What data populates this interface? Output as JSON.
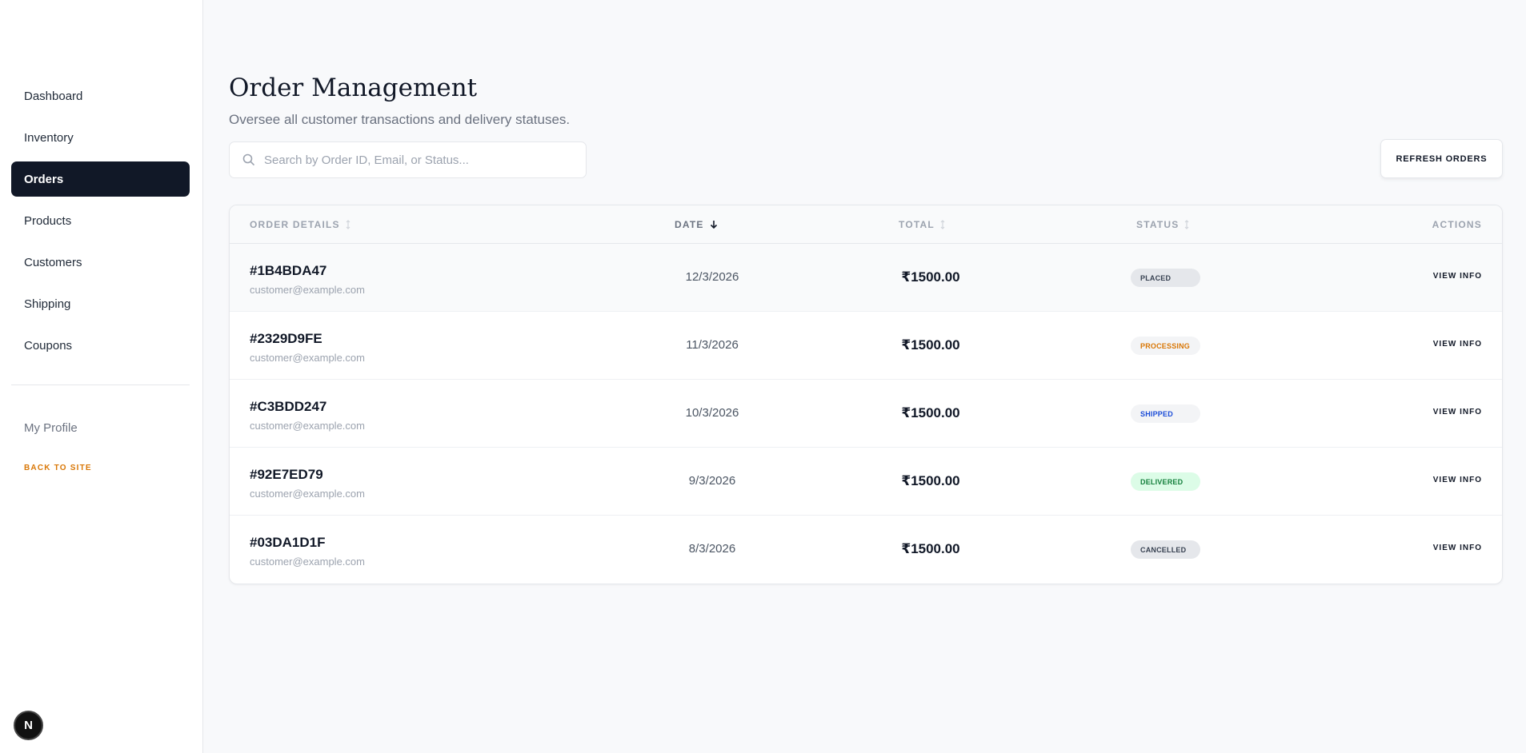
{
  "sidebar": {
    "nav": [
      {
        "label": "Dashboard",
        "active": false
      },
      {
        "label": "Inventory",
        "active": false
      },
      {
        "label": "Orders",
        "active": true
      },
      {
        "label": "Products",
        "active": false
      },
      {
        "label": "Customers",
        "active": false
      },
      {
        "label": "Shipping",
        "active": false
      },
      {
        "label": "Coupons",
        "active": false
      }
    ],
    "profile_label": "My Profile",
    "back_label": "BACK TO SITE",
    "badge_letter": "N"
  },
  "header": {
    "title": "Order Management",
    "subtitle": "Oversee all customer transactions and delivery statuses."
  },
  "search": {
    "placeholder": "Search by Order ID, Email, or Status...",
    "value": ""
  },
  "toolbar": {
    "refresh_label": "REFRESH ORDERS"
  },
  "table": {
    "columns": {
      "details": "ORDER DETAILS",
      "date": "DATE",
      "total": "TOTAL",
      "status": "STATUS",
      "actions": "ACTIONS"
    },
    "sorted_column": "date",
    "sort_direction": "desc",
    "action_label": "VIEW INFO",
    "rows": [
      {
        "id": "#1B4BDA47",
        "email": "customer@example.com",
        "date": "12/3/2026",
        "total": "₹1500.00",
        "status": "PLACED"
      },
      {
        "id": "#2329D9FE",
        "email": "customer@example.com",
        "date": "11/3/2026",
        "total": "₹1500.00",
        "status": "PROCESSING"
      },
      {
        "id": "#C3BDD247",
        "email": "customer@example.com",
        "date": "10/3/2026",
        "total": "₹1500.00",
        "status": "SHIPPED"
      },
      {
        "id": "#92E7ED79",
        "email": "customer@example.com",
        "date": "9/3/2026",
        "total": "₹1500.00",
        "status": "DELIVERED"
      },
      {
        "id": "#03DA1D1F",
        "email": "customer@example.com",
        "date": "8/3/2026",
        "total": "₹1500.00",
        "status": "CANCELLED"
      }
    ]
  },
  "status_colors": {
    "PLACED": {
      "bg": "#e5e7eb",
      "fg": "#374151"
    },
    "PROCESSING": {
      "bg": "#f3f4f6",
      "fg": "#d97706"
    },
    "SHIPPED": {
      "bg": "#f3f4f6",
      "fg": "#1d4ed8"
    },
    "DELIVERED": {
      "bg": "#dcfce7",
      "fg": "#15803d"
    },
    "CANCELLED": {
      "bg": "#e5e7eb",
      "fg": "#374151"
    }
  },
  "colors": {
    "primary_dark": "#111827",
    "accent": "#d97706"
  }
}
